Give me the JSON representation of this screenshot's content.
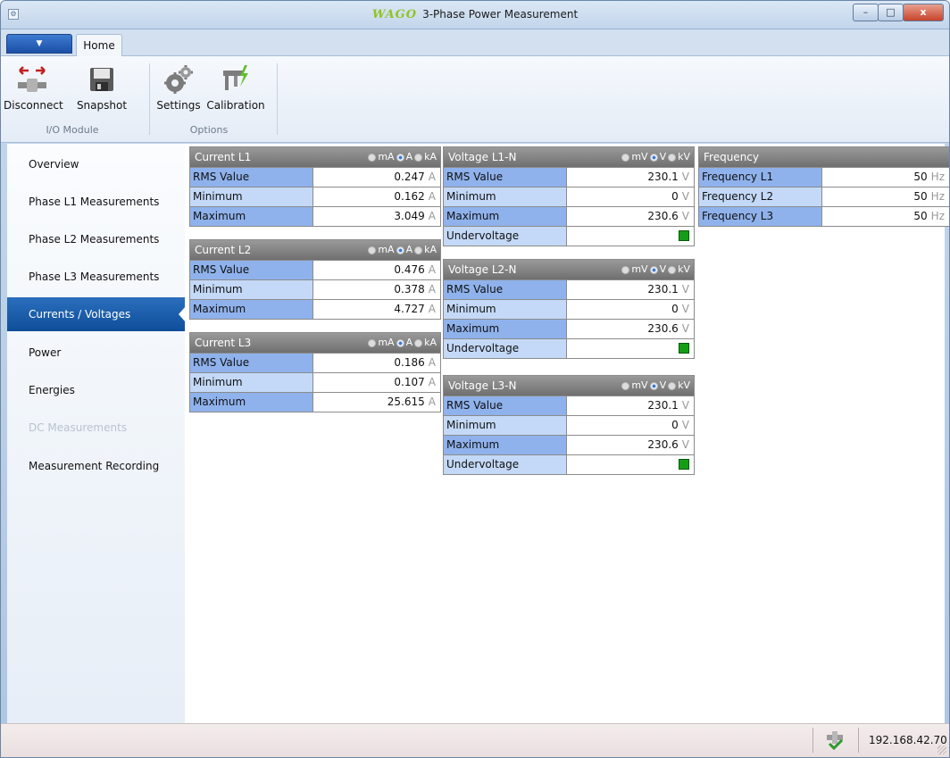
{
  "window": {
    "title": "3-Phase Power Measurement",
    "logo": "WAGO",
    "app_icon": "app-icon",
    "buttons": {
      "minimize": "–",
      "maximize": "□",
      "close": "x"
    }
  },
  "ribbon": {
    "tab": "Home",
    "groups": [
      {
        "label": "I/O Module",
        "buttons": [
          {
            "label": "Disconnect",
            "icon": "disconnect-icon"
          },
          {
            "label": "Snapshot",
            "icon": "save-icon"
          }
        ]
      },
      {
        "label": "Options",
        "buttons": [
          {
            "label": "Settings",
            "icon": "gears-icon"
          },
          {
            "label": "Calibration",
            "icon": "caliper-icon"
          }
        ]
      }
    ]
  },
  "sidebar": {
    "items": [
      {
        "label": "Overview",
        "state": "normal"
      },
      {
        "label": "Phase L1 Measurements",
        "state": "normal"
      },
      {
        "label": "Phase L2 Measurements",
        "state": "normal"
      },
      {
        "label": "Phase L3 Measurements",
        "state": "normal"
      },
      {
        "label": "Currents / Voltages",
        "state": "active"
      },
      {
        "label": "Power",
        "state": "normal"
      },
      {
        "label": "Energies",
        "state": "normal"
      },
      {
        "label": "DC Measurements",
        "state": "disabled"
      },
      {
        "label": "Measurement Recording",
        "state": "normal"
      }
    ]
  },
  "current_units": [
    "mA",
    "A",
    "kA"
  ],
  "voltage_units": [
    "mV",
    "V",
    "kV"
  ],
  "panels": {
    "current_l1": {
      "title": "Current L1",
      "selected_unit": "A",
      "rows": [
        {
          "label": "RMS Value",
          "value": "0.247",
          "unit": "A"
        },
        {
          "label": "Minimum",
          "value": "0.162",
          "unit": "A"
        },
        {
          "label": "Maximum",
          "value": "3.049",
          "unit": "A"
        }
      ]
    },
    "current_l2": {
      "title": "Current L2",
      "selected_unit": "A",
      "rows": [
        {
          "label": "RMS Value",
          "value": "0.476",
          "unit": "A"
        },
        {
          "label": "Minimum",
          "value": "0.378",
          "unit": "A"
        },
        {
          "label": "Maximum",
          "value": "4.727",
          "unit": "A"
        }
      ]
    },
    "current_l3": {
      "title": "Current L3",
      "selected_unit": "A",
      "rows": [
        {
          "label": "RMS Value",
          "value": "0.186",
          "unit": "A"
        },
        {
          "label": "Minimum",
          "value": "0.107",
          "unit": "A"
        },
        {
          "label": "Maximum",
          "value": "25.615",
          "unit": "A"
        }
      ]
    },
    "voltage_l1": {
      "title": "Voltage L1-N",
      "selected_unit": "V",
      "rows": [
        {
          "label": "RMS Value",
          "value": "230.1",
          "unit": "V"
        },
        {
          "label": "Minimum",
          "value": "0",
          "unit": "V"
        },
        {
          "label": "Maximum",
          "value": "230.6",
          "unit": "V"
        }
      ],
      "undervoltage_label": "Undervoltage",
      "indicator_color": "#159e15"
    },
    "voltage_l2": {
      "title": "Voltage L2-N",
      "selected_unit": "V",
      "rows": [
        {
          "label": "RMS Value",
          "value": "230.1",
          "unit": "V"
        },
        {
          "label": "Minimum",
          "value": "0",
          "unit": "V"
        },
        {
          "label": "Maximum",
          "value": "230.6",
          "unit": "V"
        }
      ],
      "undervoltage_label": "Undervoltage",
      "indicator_color": "#159e15"
    },
    "voltage_l3": {
      "title": "Voltage L3-N",
      "selected_unit": "V",
      "rows": [
        {
          "label": "RMS Value",
          "value": "230.1",
          "unit": "V"
        },
        {
          "label": "Minimum",
          "value": "0",
          "unit": "V"
        },
        {
          "label": "Maximum",
          "value": "230.6",
          "unit": "V"
        }
      ],
      "undervoltage_label": "Undervoltage",
      "indicator_color": "#159e15"
    },
    "frequency": {
      "title": "Frequency",
      "rows": [
        {
          "label": "Frequency L1",
          "value": "50",
          "unit": "Hz"
        },
        {
          "label": "Frequency L2",
          "value": "50",
          "unit": "Hz"
        },
        {
          "label": "Frequency L3",
          "value": "50",
          "unit": "Hz"
        }
      ]
    }
  },
  "statusbar": {
    "ip": "192.168.42.70",
    "icon": "connection-ok-icon"
  }
}
